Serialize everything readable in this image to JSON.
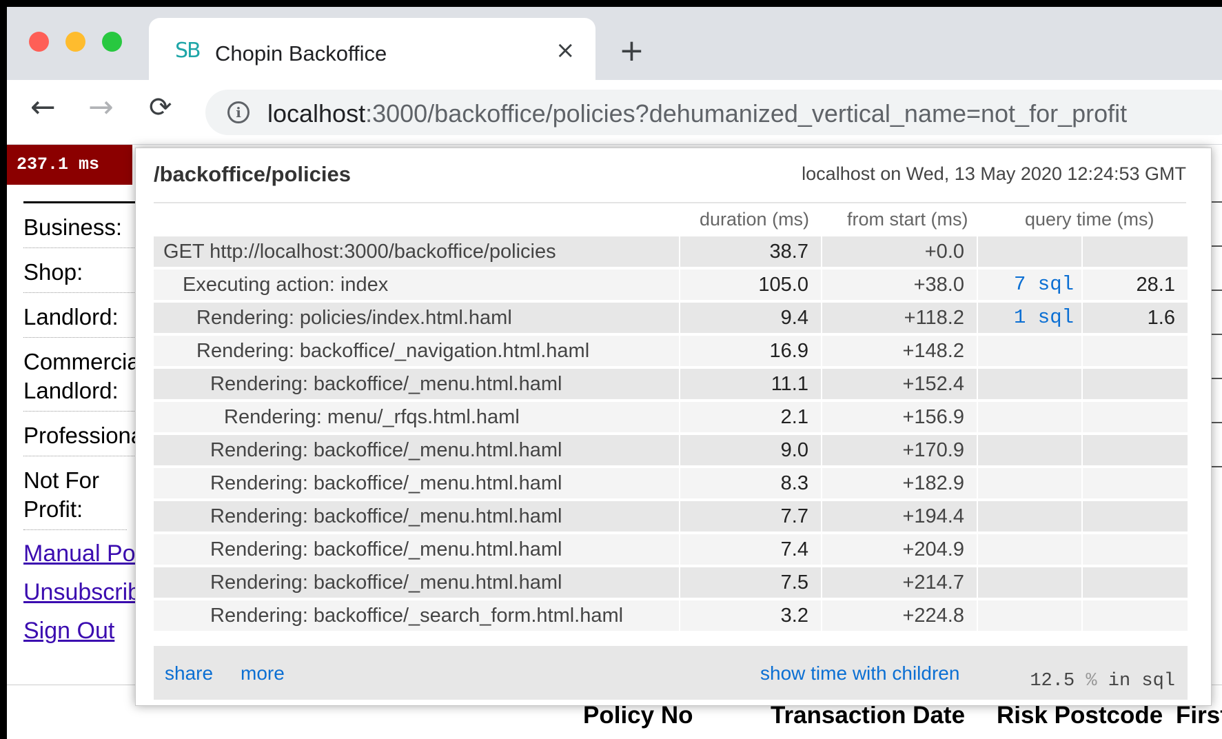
{
  "tab": {
    "logo": "SB",
    "title": "Chopin Backoffice",
    "close": "×",
    "new_tab": "+"
  },
  "toolbar": {
    "back": "←",
    "forward": "→",
    "reload": "⟳",
    "url_host": "localhost",
    "url_rest": ":3000/backoffice/policies?dehumanized_vertical_name=not_for_profit"
  },
  "page": {
    "timing_badge": "237.1 ms",
    "sidebar": [
      "Business:",
      "Shop:",
      "Landlord:",
      "Commercial Landlord:",
      "Professional:",
      "Not For Profit:"
    ],
    "links": [
      "Manual Policies",
      "Unsubscribe",
      "Sign Out"
    ],
    "table_headers": [
      "Policy No",
      "Transaction Date",
      "Risk Postcode",
      "First"
    ]
  },
  "profiler": {
    "path": "/backoffice/policies",
    "server": "localhost on Wed, 13 May 2020 12:24:53 GMT",
    "columns": {
      "duration": "duration (ms)",
      "from_start": "from start (ms)",
      "query_time": "query time (ms)"
    },
    "rows": [
      {
        "name": "GET http://localhost:3000/backoffice/policies",
        "indent": 0,
        "duration": "38.7",
        "start": "+0.0",
        "sql": "",
        "qtime": ""
      },
      {
        "name": "Executing action: index",
        "indent": 1,
        "duration": "105.0",
        "start": "+38.0",
        "sql": "7 sql",
        "qtime": "28.1"
      },
      {
        "name": "Rendering: policies/index.html.haml",
        "indent": 2,
        "duration": "9.4",
        "start": "+118.2",
        "sql": "1 sql",
        "qtime": "1.6"
      },
      {
        "name": "Rendering: backoffice/_navigation.html.haml",
        "indent": 2,
        "duration": "16.9",
        "start": "+148.2",
        "sql": "",
        "qtime": ""
      },
      {
        "name": "Rendering: backoffice/_menu.html.haml",
        "indent": 3,
        "duration": "11.1",
        "start": "+152.4",
        "sql": "",
        "qtime": ""
      },
      {
        "name": "Rendering: menu/_rfqs.html.haml",
        "indent": 4,
        "duration": "2.1",
        "start": "+156.9",
        "sql": "",
        "qtime": ""
      },
      {
        "name": "Rendering: backoffice/_menu.html.haml",
        "indent": 3,
        "duration": "9.0",
        "start": "+170.9",
        "sql": "",
        "qtime": ""
      },
      {
        "name": "Rendering: backoffice/_menu.html.haml",
        "indent": 3,
        "duration": "8.3",
        "start": "+182.9",
        "sql": "",
        "qtime": ""
      },
      {
        "name": "Rendering: backoffice/_menu.html.haml",
        "indent": 3,
        "duration": "7.7",
        "start": "+194.4",
        "sql": "",
        "qtime": ""
      },
      {
        "name": "Rendering: backoffice/_menu.html.haml",
        "indent": 3,
        "duration": "7.4",
        "start": "+204.9",
        "sql": "",
        "qtime": ""
      },
      {
        "name": "Rendering: backoffice/_menu.html.haml",
        "indent": 3,
        "duration": "7.5",
        "start": "+214.7",
        "sql": "",
        "qtime": ""
      },
      {
        "name": "Rendering: backoffice/_search_form.html.haml",
        "indent": 3,
        "duration": "3.2",
        "start": "+224.8",
        "sql": "",
        "qtime": ""
      }
    ],
    "footer": {
      "share": "share",
      "more": "more",
      "show_children": "show time with children",
      "sql_value": "12.5",
      "sql_pct": "%",
      "sql_suffix": "in sql"
    }
  }
}
